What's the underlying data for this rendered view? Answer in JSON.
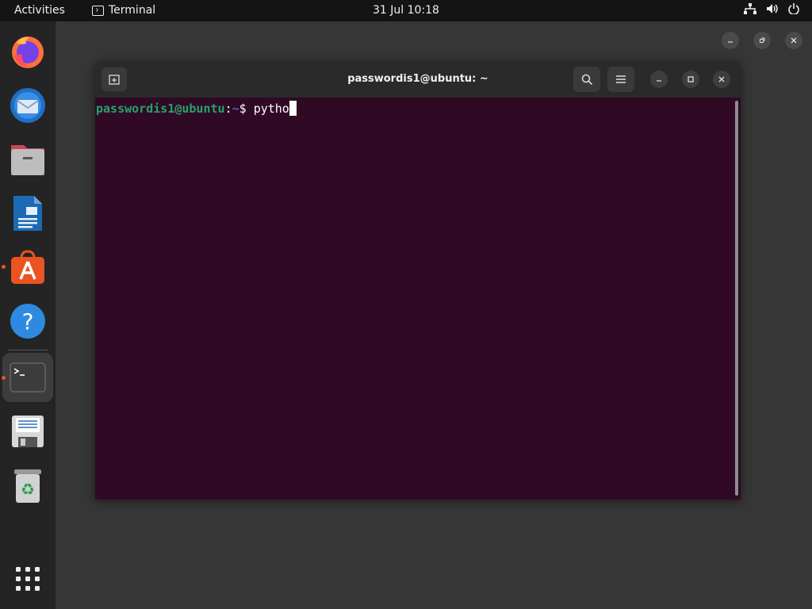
{
  "topbar": {
    "activities": "Activities",
    "app_name": "Terminal",
    "clock": "31 Jul  10:18",
    "icons": [
      "network-icon",
      "volume-icon",
      "power-icon"
    ]
  },
  "dock": {
    "items": [
      {
        "name": "firefox",
        "icon": "firefox-icon"
      },
      {
        "name": "thunderbird",
        "icon": "thunderbird-icon"
      },
      {
        "name": "files",
        "icon": "files-icon"
      },
      {
        "name": "writer",
        "icon": "libreoffice-writer-icon"
      },
      {
        "name": "software",
        "icon": "app-center-icon"
      },
      {
        "name": "help",
        "icon": "help-icon"
      },
      {
        "name": "terminal",
        "icon": "terminal-icon"
      },
      {
        "name": "save",
        "icon": "floppy-save-icon"
      },
      {
        "name": "trash",
        "icon": "trash-icon"
      },
      {
        "name": "app-grid",
        "icon": "show-apps-icon"
      }
    ],
    "running": [
      "software",
      "terminal"
    ]
  },
  "terminal": {
    "title": "passwordis1@ubuntu: ~",
    "prompt_user": "passwordis1@ubuntu",
    "prompt_colon": ":",
    "prompt_path": "~",
    "prompt_symbol": "$ ",
    "command": "pytho"
  },
  "colors": {
    "terminal_bg": "#300a24",
    "prompt_user": "#26a269",
    "prompt_path": "#3f6fbf",
    "accent": "#e95420"
  }
}
